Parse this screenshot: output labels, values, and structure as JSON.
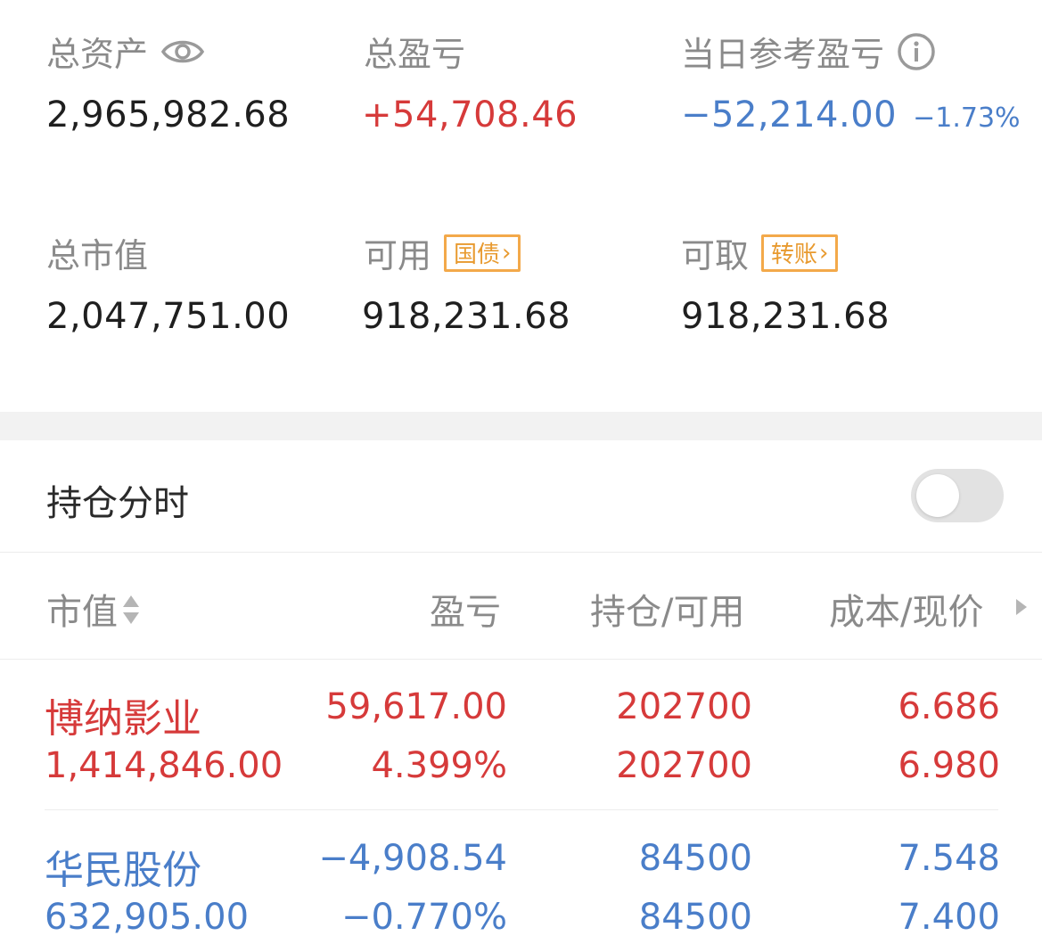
{
  "summary": {
    "total_assets_label": "总资产",
    "total_assets_value": "2,965,982.68",
    "total_pnl_label": "总盈亏",
    "total_pnl_value": "+54,708.46",
    "daily_pnl_label": "当日参考盈亏",
    "daily_pnl_value": "−52,214.00",
    "daily_pnl_pct": "−1.73%",
    "market_value_label": "总市值",
    "market_value_value": "2,047,751.00",
    "available_label": "可用",
    "available_tag": "国债",
    "available_value": "918,231.68",
    "withdrawable_label": "可取",
    "withdrawable_tag": "转账",
    "withdrawable_value": "918,231.68"
  },
  "toggle": {
    "label": "持仓分时",
    "on": false
  },
  "columns": {
    "market_value": "市值",
    "pnl": "盈亏",
    "position": "持仓/可用",
    "cost": "成本/现价"
  },
  "holdings": [
    {
      "name": "博纳影业",
      "market_value": "1,414,846.00",
      "pnl": "59,617.00",
      "pnl_pct": "4.399%",
      "position": "202700",
      "available": "202700",
      "cost": "6.686",
      "price": "6.980",
      "tone": "up"
    },
    {
      "name": "华民股份",
      "market_value": "632,905.00",
      "pnl": "−4,908.54",
      "pnl_pct": "−0.770%",
      "position": "84500",
      "available": "84500",
      "cost": "7.548",
      "price": "7.400",
      "tone": "down"
    }
  ],
  "colors": {
    "up": "#d63a3a",
    "down": "#4a7ec9",
    "accent": "#f3a94a"
  },
  "icons": {
    "eye": "eye-icon",
    "info": "info-icon",
    "sort": "sort-icon",
    "more": "chevron-right-icon"
  }
}
